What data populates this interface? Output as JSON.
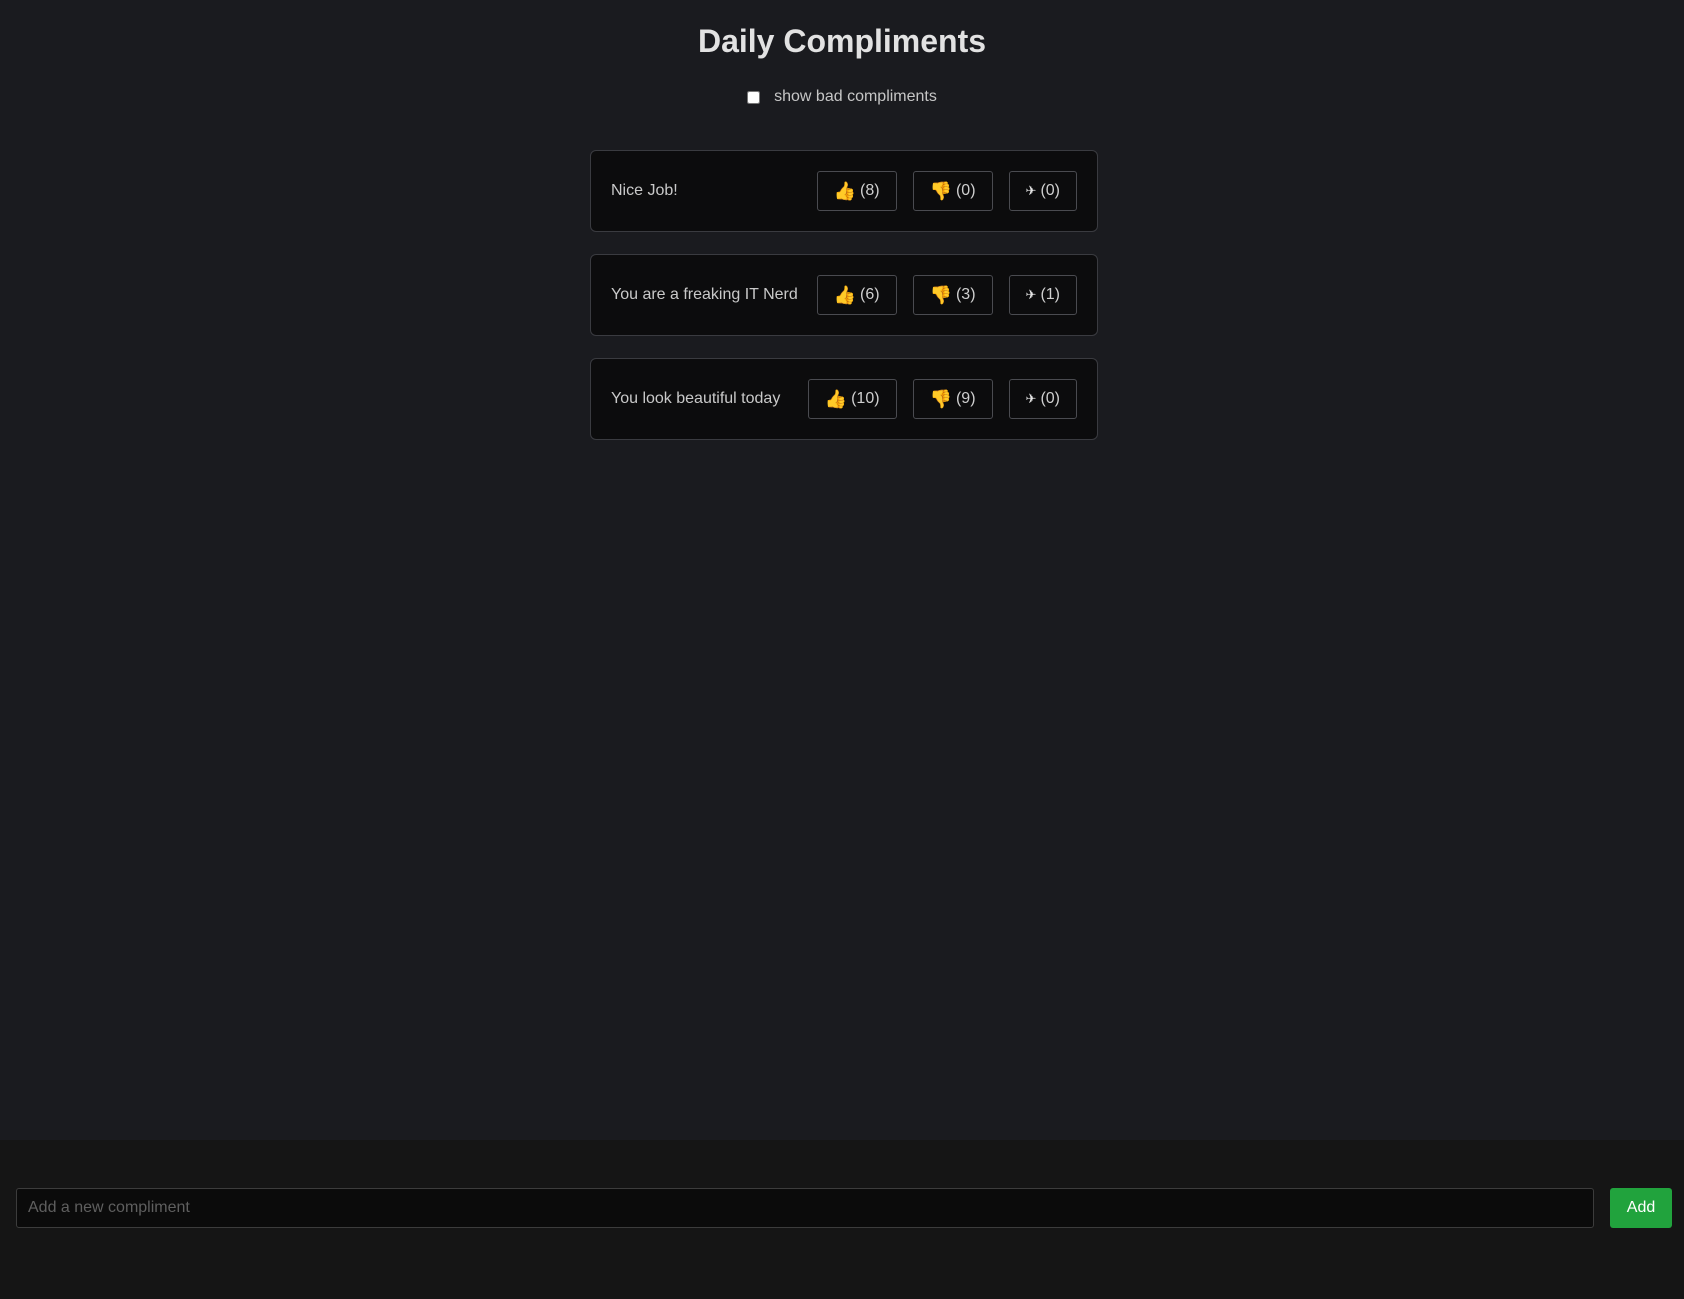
{
  "app": {
    "title": "Daily Compliments"
  },
  "filter": {
    "label": "show bad compliments",
    "checked": false
  },
  "compliments": [
    {
      "text": "Nice Job!",
      "up": "(8)",
      "down": "(0)",
      "share": "(0)"
    },
    {
      "text": "You are a freaking IT Nerd",
      "up": "(6)",
      "down": "(3)",
      "share": "(1)"
    },
    {
      "text": "You look beautiful today",
      "up": "(10)",
      "down": "(9)",
      "share": "(0)"
    }
  ],
  "icons": {
    "upvote": "👍",
    "downvote": "👎",
    "share": "✈"
  },
  "composer": {
    "placeholder": "Add a new compliment",
    "value": "",
    "add_label": "Add"
  },
  "colors": {
    "background": "#1a1b1f",
    "card": "#0c0c0d",
    "footer": "#151515",
    "accent": "#21a33d"
  }
}
